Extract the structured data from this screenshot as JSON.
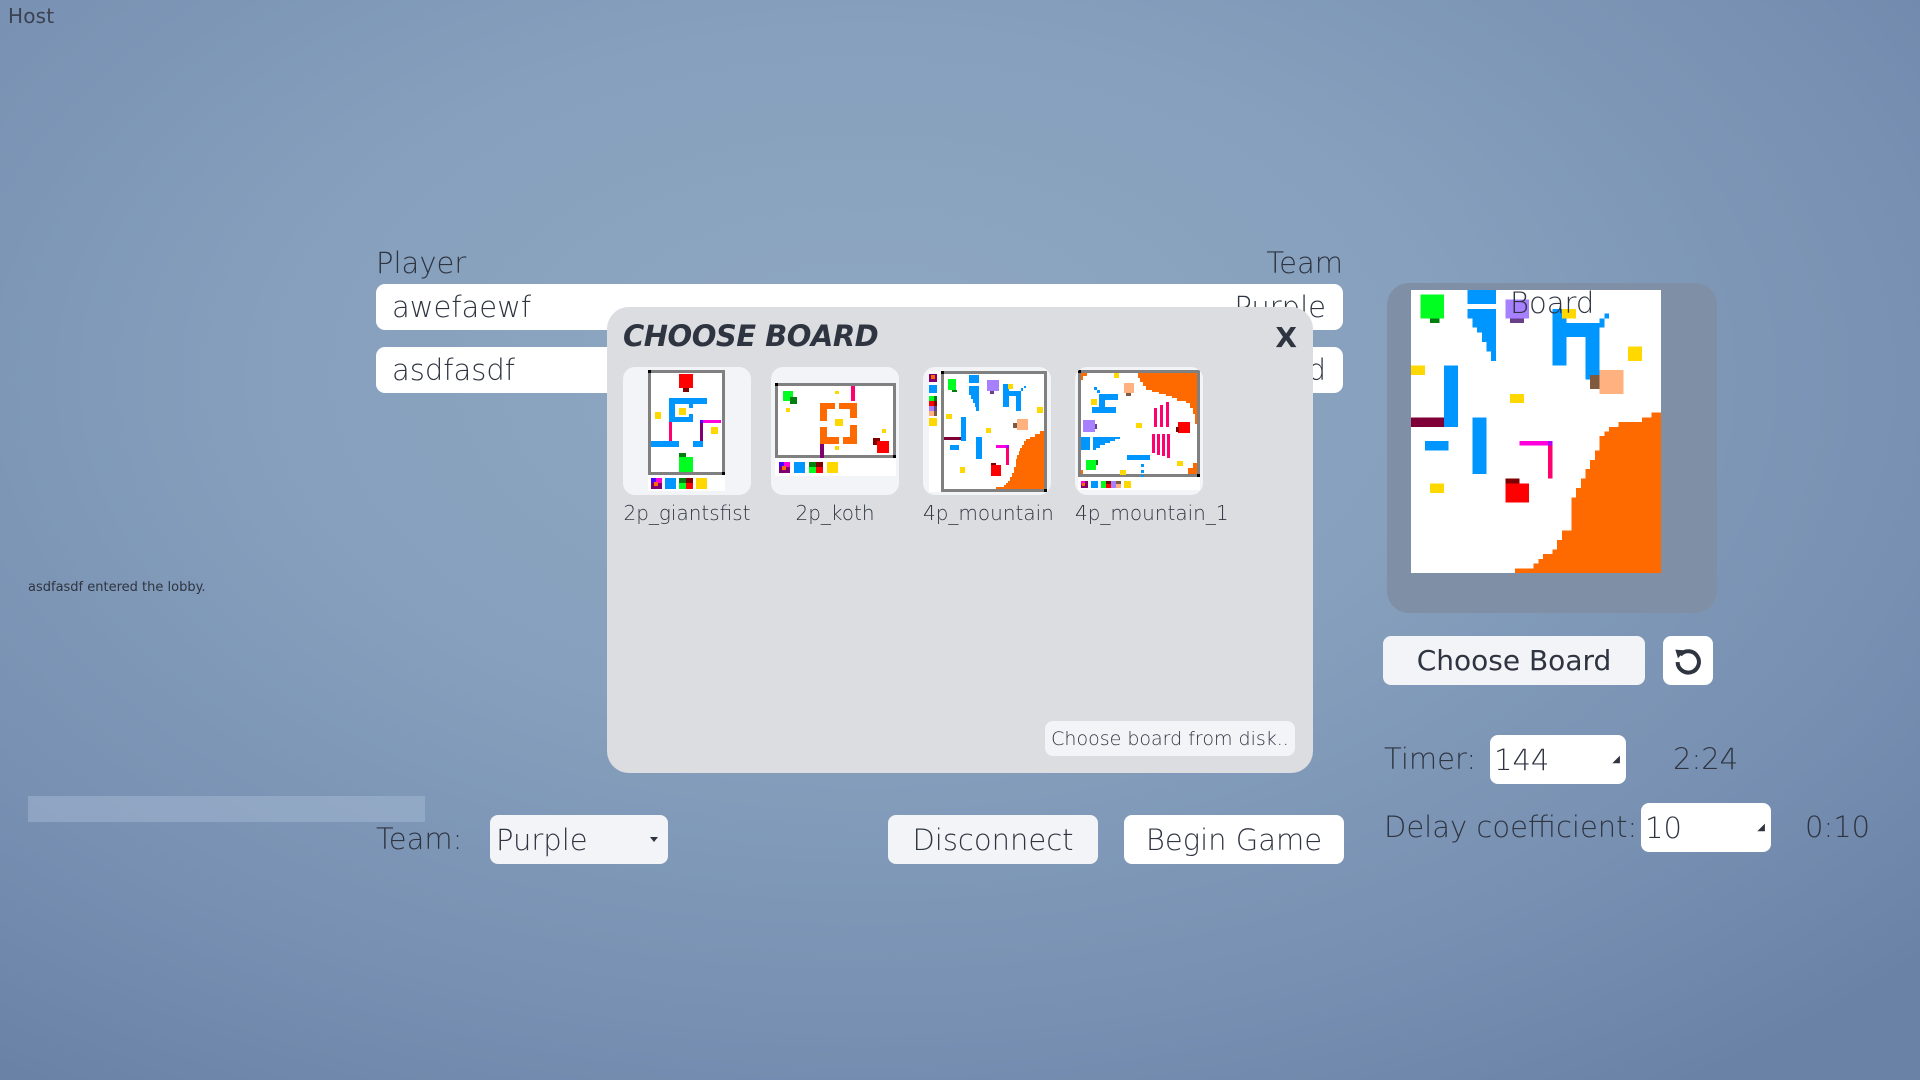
{
  "role_label": "Host",
  "players_table": {
    "player_header": "Player",
    "team_header": "Team",
    "rows": [
      {
        "name": "awefaewf",
        "team": "Purple"
      },
      {
        "name": "asdfasdf",
        "team": "Red"
      }
    ]
  },
  "chat": {
    "messages": [
      "asdfasdf entered the lobby."
    ],
    "input_value": ""
  },
  "controls": {
    "team_label": "Team:",
    "team_selected": "Purple",
    "disconnect_label": "Disconnect",
    "begin_label": "Begin Game"
  },
  "board_panel": {
    "label": "Board",
    "choose_label": "Choose Board",
    "refresh_icon": "refresh-icon"
  },
  "settings": {
    "timer_label": "Timer:",
    "timer_value": "144",
    "timer_display": "2:24",
    "delay_label": "Delay coefficient:",
    "delay_value": "10",
    "delay_display": "0:10"
  },
  "modal": {
    "title": "CHOOSE BOARD",
    "close_label": "X",
    "boards": [
      {
        "name": "2p_giantsfist"
      },
      {
        "name": "2p_koth"
      },
      {
        "name": "4p_mountain"
      },
      {
        "name": "4p_mountain_1"
      }
    ],
    "disk_label": "Choose board from disk.."
  },
  "colors": {
    "blue": "#0096ff",
    "orange": "#ff6a00",
    "green": "#00ff21",
    "red": "#ff0000",
    "purple": "#a680ff",
    "peach": "#ffb27f",
    "yellow": "#ffd800",
    "magenta": "#ff00dc",
    "pink": "#ff006e",
    "wall": "#808080"
  }
}
